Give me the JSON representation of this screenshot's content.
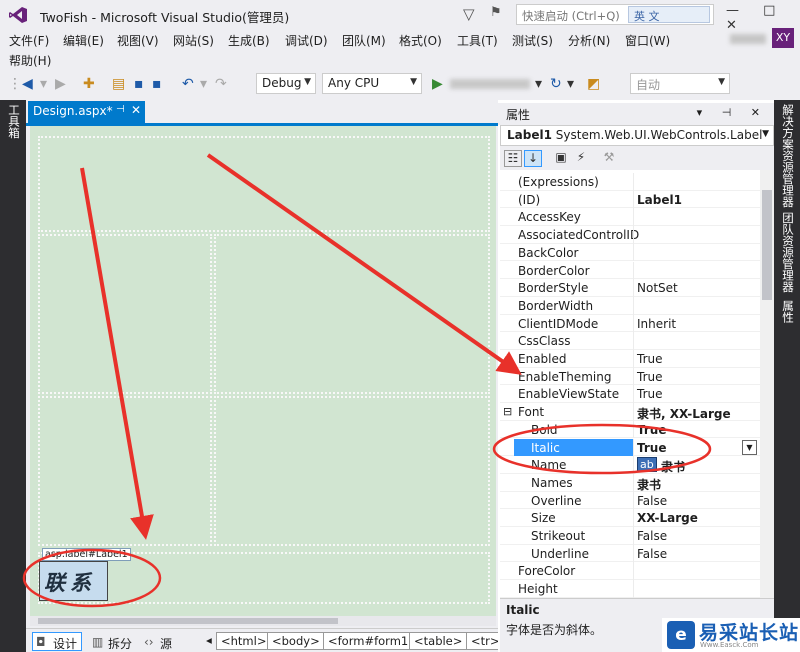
{
  "window": {
    "title": "TwoFish - Microsoft Visual Studio(管理员)",
    "controls": "— □ ✕"
  },
  "quick_launch": {
    "placeholder": "快速启动 (Ctrl+Q)",
    "ime_badge": "英 文"
  },
  "user": {
    "initials": "XY"
  },
  "menu": [
    "文件(F)",
    "编辑(E)",
    "视图(V)",
    "网站(S)",
    "生成(B)",
    "调试(D)",
    "团队(M)",
    "格式(O)",
    "工具(T)",
    "测试(S)",
    "分析(N)",
    "窗口(W)",
    "帮助(H)"
  ],
  "toolbar": {
    "config": "Debug",
    "platform": "Any CPU",
    "auto_label": "自动"
  },
  "left_sidebar": {
    "toolbox": "工具箱"
  },
  "editor": {
    "tab_label": "Design.aspx*",
    "tab_pin": "⊣",
    "tab_close": "✕",
    "label_tag": "asp:label#Label1",
    "label_text": "联系"
  },
  "bottom_bar": {
    "views": [
      "设计",
      "拆分",
      "源"
    ],
    "breadcrumbs": [
      "<html>",
      "<body>",
      "<form#form1>",
      "<table>",
      "<tr>"
    ]
  },
  "properties": {
    "panel_title": "属性",
    "panel_controls": "▾ ⊣ ✕",
    "object_name": "Label1",
    "object_type": "System.Web.UI.WebControls.Label",
    "rows": [
      {
        "name": "(Expressions)",
        "value": ""
      },
      {
        "name": "(ID)",
        "value": "Label1",
        "bold": true
      },
      {
        "name": "AccessKey",
        "value": ""
      },
      {
        "name": "AssociatedControlID",
        "value": ""
      },
      {
        "name": "BackColor",
        "value": ""
      },
      {
        "name": "BorderColor",
        "value": ""
      },
      {
        "name": "BorderStyle",
        "value": "NotSet"
      },
      {
        "name": "BorderWidth",
        "value": ""
      },
      {
        "name": "ClientIDMode",
        "value": "Inherit"
      },
      {
        "name": "CssClass",
        "value": ""
      },
      {
        "name": "Enabled",
        "value": "True"
      },
      {
        "name": "EnableTheming",
        "value": "True"
      },
      {
        "name": "EnableViewState",
        "value": "True"
      },
      {
        "name": "Font",
        "value": "隶书, XX-Large",
        "bold": true,
        "expander": "⊟"
      },
      {
        "name": "Bold",
        "value": "True",
        "bold": true,
        "indent": true
      },
      {
        "name": "Italic",
        "value": "True",
        "bold": true,
        "indent": true,
        "selected": true
      },
      {
        "name": "Name",
        "value": "隶书",
        "bold": true,
        "indent": true,
        "swatch": "ab"
      },
      {
        "name": "Names",
        "value": "隶书",
        "bold": true,
        "indent": true
      },
      {
        "name": "Overline",
        "value": "False",
        "indent": true
      },
      {
        "name": "Size",
        "value": "XX-Large",
        "bold": true,
        "indent": true
      },
      {
        "name": "Strikeout",
        "value": "False",
        "indent": true
      },
      {
        "name": "Underline",
        "value": "False",
        "indent": true
      },
      {
        "name": "ForeColor",
        "value": ""
      },
      {
        "name": "Height",
        "value": ""
      }
    ],
    "description_title": "Italic",
    "description_text": "字体是否为斜体。"
  },
  "right_sidebar": [
    "解决方案资源管理器",
    "团队资源管理器",
    "属性"
  ],
  "watermark": {
    "text": "易采站长站",
    "url": "Www.Easck.Com",
    "logo_char": "e"
  },
  "colors": {
    "accent": "#007acc",
    "selection": "#3399ff",
    "annotation": "#e8312a",
    "vs_purple": "#68217a",
    "design_bg": "#d1e5d1"
  }
}
